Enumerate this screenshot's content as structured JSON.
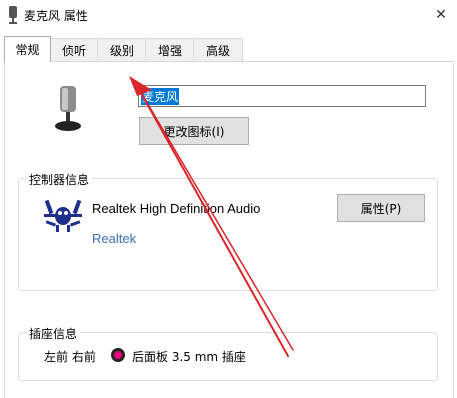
{
  "window": {
    "title": "麦克风 属性",
    "close_glyph": "✕"
  },
  "tabs": [
    {
      "label": "常规",
      "active": true
    },
    {
      "label": "侦听",
      "active": false
    },
    {
      "label": "级别",
      "active": false
    },
    {
      "label": "增强",
      "active": false
    },
    {
      "label": "高级",
      "active": false
    }
  ],
  "device": {
    "name_value": "麦克风",
    "change_icon_label": "更改图标(I)"
  },
  "controller": {
    "group_label": "控制器信息",
    "name": "Realtek High Definition Audio",
    "vendor_link": "Realtek",
    "properties_label": "属性(P)"
  },
  "jack": {
    "group_label": "插座信息",
    "channels": "左前 右前",
    "description": "后面板 3.5 mm 插座",
    "color": "#e6007e"
  },
  "annotation": {
    "arrow_color": "#d9262b"
  },
  "icons": [
    "speaker-icon",
    "close-icon",
    "microphone-icon",
    "realtek-crab-icon",
    "jack-color-icon",
    "annotation-arrow"
  ]
}
